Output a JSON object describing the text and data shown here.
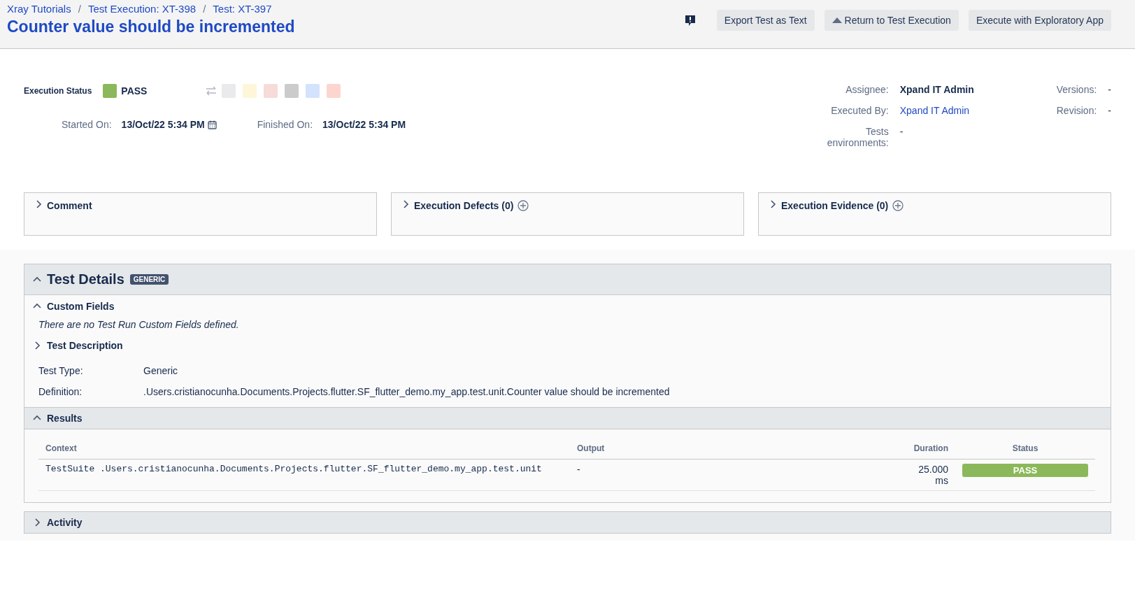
{
  "breadcrumbs": [
    {
      "label": "Xray Tutorials"
    },
    {
      "separator": "/",
      "label": "Test Execution: XT-398"
    },
    {
      "separator": "/",
      "label": "Test: XT-397"
    }
  ],
  "title": "Counter value should be incremented",
  "header_buttons": [
    {
      "kind": "plain",
      "label": "Export Test as Text"
    },
    {
      "kind": "caret",
      "label": "Return to Test Execution"
    },
    {
      "kind": "plain",
      "label": "Execute with Exploratory App"
    }
  ],
  "execution_status": {
    "label": "Execution Status",
    "value": "PASS",
    "color": "#8bb85a"
  },
  "status_options": [
    {
      "color": "#e9eaec"
    },
    {
      "color": "#fdf6d9"
    },
    {
      "color": "#f6dbd9"
    },
    {
      "color": "#cbcbcb"
    },
    {
      "color": "#d3e2fd"
    },
    {
      "color": "#fdd5cf"
    }
  ],
  "dates": [
    {
      "label": "Started On:",
      "value": "13/Oct/22 5:34 PM",
      "kind": "picker"
    },
    {
      "label": "Finished On:",
      "value": "13/Oct/22 5:34 PM",
      "kind": "plain"
    }
  ],
  "people": [
    {
      "label": "Assignee:",
      "value": "Xpand IT Admin",
      "kind": "bold"
    },
    {
      "label": "Executed By:",
      "value": "Xpand IT Admin",
      "kind": "link"
    },
    {
      "label": "Tests environments:",
      "value": "-",
      "kind": "plain"
    }
  ],
  "versions": [
    {
      "label": "Versions:",
      "value": "-"
    },
    {
      "label": "Revision:",
      "value": "-"
    }
  ],
  "panels": [
    {
      "title": "Comment",
      "add": false,
      "expanded": false
    },
    {
      "title": "Execution Defects (0)",
      "add": true,
      "expanded": false
    },
    {
      "title": "Execution Evidence (0)",
      "add": true,
      "expanded": false
    }
  ],
  "test_details": {
    "title": "Test Details",
    "badge": "GENERIC",
    "expanded": true,
    "custom_fields": {
      "title": "Custom Fields",
      "expanded": true,
      "message": "There are no Test Run Custom Fields defined."
    },
    "description": {
      "title": "Test Description",
      "expanded": false
    },
    "fields": [
      {
        "label": "Test Type:",
        "value": "Generic"
      },
      {
        "label": "Definition:",
        "value": ".Users.cristianocunha.Documents.Projects.flutter.SF_flutter_demo.my_app.test.unit.Counter value should be incremented"
      }
    ],
    "results": {
      "title": "Results",
      "expanded": true,
      "columns": [
        "Context",
        "Output",
        "Duration",
        "Status"
      ],
      "rows": [
        {
          "context": "TestSuite .Users.cristianocunha.Documents.Projects.flutter.SF_flutter_demo.my_app.test.unit",
          "output": "-",
          "duration": "25.000 ms",
          "status": "PASS",
          "color": "#8bb85a"
        }
      ]
    }
  },
  "activity": {
    "title": "Activity",
    "expanded": false
  }
}
